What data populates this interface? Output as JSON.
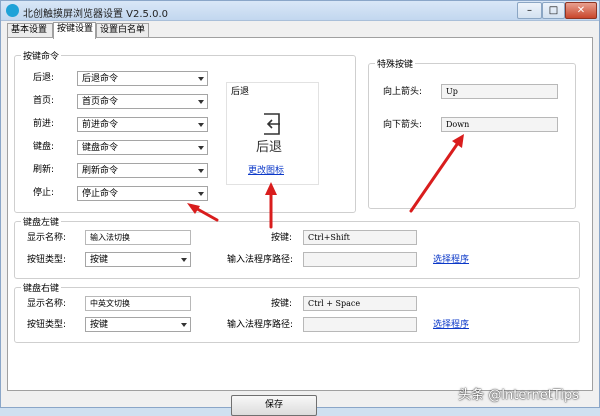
{
  "window": {
    "title": "北创触摸屏浏览器设置 V2.5.0.0",
    "minimize": "–",
    "maximize": "□",
    "close": "✕"
  },
  "tabs": [
    {
      "label": "基本设置"
    },
    {
      "label": "按键设置"
    },
    {
      "label": "设置白名单"
    }
  ],
  "key_commands": {
    "legend": "按键命令",
    "rows": [
      {
        "label": "后退:",
        "value": "后退命令"
      },
      {
        "label": "首页:",
        "value": "首页命令"
      },
      {
        "label": "前进:",
        "value": "前进命令"
      },
      {
        "label": "键盘:",
        "value": "键盘命令"
      },
      {
        "label": "刷新:",
        "value": "刷新命令"
      },
      {
        "label": "停止:",
        "value": "停止命令"
      }
    ]
  },
  "preview": {
    "title": "后退",
    "icon": "exit-icon",
    "label": "后退",
    "change_icon": "更改图标"
  },
  "special_keys": {
    "legend": "特殊按键",
    "up_label": "向上箭头:",
    "up_value": "Up",
    "down_label": "向下箭头:",
    "down_value": "Down"
  },
  "left_key": {
    "legend": "键盘左键",
    "name_label": "显示名称:",
    "name_value": "输入法切换",
    "key_label": "按键:",
    "key_value": "Ctrl+Shift",
    "type_label": "按钮类型:",
    "type_value": "按键",
    "path_label": "输入法程序路径:",
    "path_value": "",
    "choose": "选择程序"
  },
  "right_key": {
    "legend": "键盘右键",
    "name_label": "显示名称:",
    "name_value": "中英文切换",
    "key_label": "按键:",
    "key_value": "Ctrl + Space",
    "type_label": "按钮类型:",
    "type_value": "按键",
    "path_label": "输入法程序路径:",
    "path_value": "",
    "choose": "选择程序"
  },
  "save_label": "保存",
  "watermark": "头条 @InternetTips",
  "colors": {
    "arrow": "#d91d1d",
    "link": "#0b38c8",
    "title_bar": "#c2d7ef"
  }
}
